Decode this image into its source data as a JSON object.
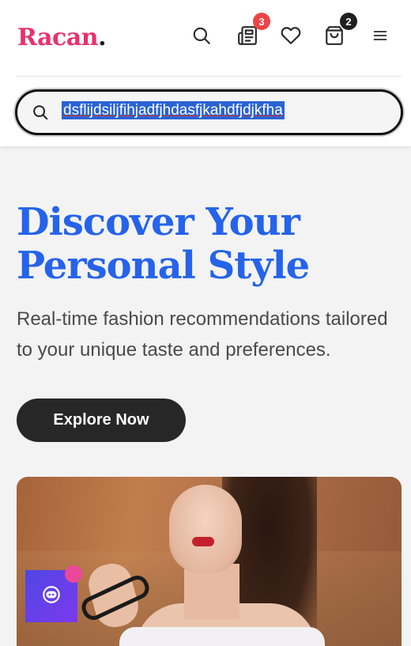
{
  "header": {
    "logo_text": "Racan",
    "logo_dot": ".",
    "icons": {
      "search": "search-icon",
      "news": "newspaper-icon",
      "wishlist": "heart-icon",
      "cart": "shopping-bag-icon",
      "menu": "hamburger-menu-icon"
    },
    "news_badge": "3",
    "cart_badge": "2"
  },
  "search": {
    "value": "dsflijdsiljfihjadfjhdasfjkahdfjdjkfha",
    "placeholder": ""
  },
  "hero": {
    "title_line1": "Discover Your",
    "title_line2": "Personal Style",
    "subtitle": "Real-time fashion recommendations tailored to your unique taste and preferences.",
    "cta_label": "Explore Now"
  },
  "chat_widget": {
    "icon": "chatbot-icon"
  },
  "colors": {
    "brand": "#e8326c",
    "accent": "#2563eb",
    "badge_red": "#ef4444",
    "button_dark": "#272727",
    "chat_gradient_start": "#4f46e5",
    "chat_gradient_end": "#7c3aed",
    "chat_dot": "#ec4899"
  }
}
